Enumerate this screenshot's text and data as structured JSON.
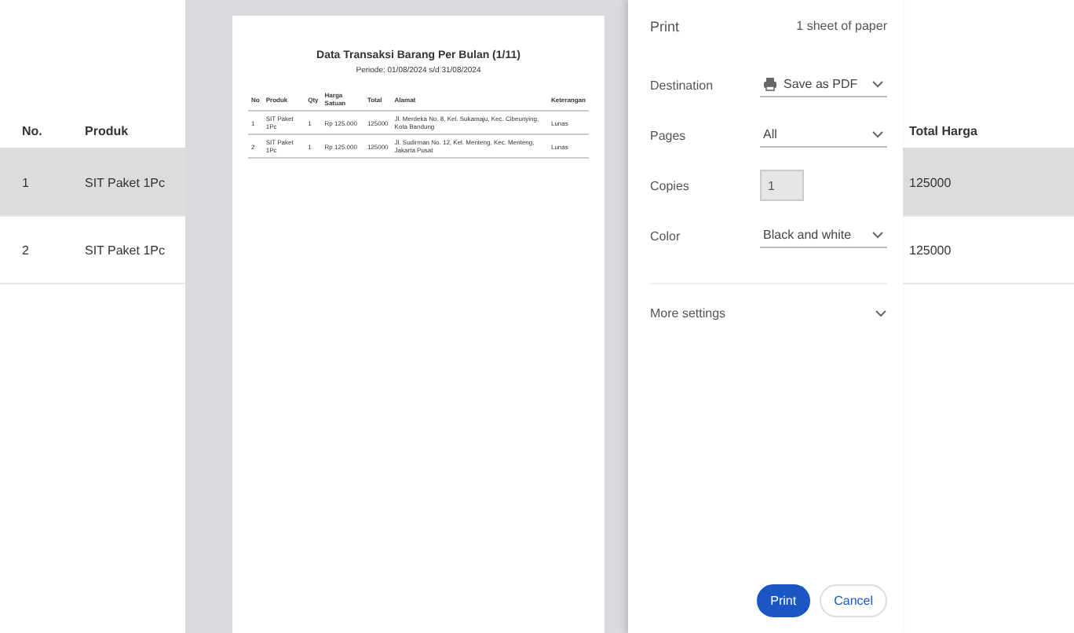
{
  "background_table": {
    "columns": [
      "No.",
      "Produk"
    ],
    "right_column": "Total Harga",
    "rows": [
      {
        "no": "1",
        "product": "SIT Paket 1Pc",
        "amount": "125000",
        "selected": true
      },
      {
        "no": "2",
        "product": "SIT Paket 1Pc",
        "amount": "125000",
        "selected": false
      }
    ]
  },
  "preview": {
    "title": "Data Transaksi Barang Per Bulan (1/11)",
    "subtitle": "Periode: 01/08/2024 s/d 31/08/2024",
    "columns": [
      "No",
      "Produk",
      "Qty",
      "Harga Satuan",
      "Total",
      "Alamat",
      "Keterangan"
    ],
    "rows": [
      [
        "1",
        "SIT Paket 1Pc",
        "1",
        "Rp 125.000",
        "125000",
        "Jl. Merdeka No. 8, Kel. Sukamaju, Kec. Cibeunying, Kota Bandung",
        "Lunas"
      ],
      [
        "2",
        "SIT Paket 1Pc",
        "1",
        "Rp 125.000",
        "125000",
        "Jl. Sudirman No. 12, Kel. Menteng, Kec. Menteng, Jakarta Pusat",
        "Lunas"
      ]
    ]
  },
  "dialog": {
    "title": "Print",
    "sheets": "1 sheet of paper",
    "fields": [
      {
        "label": "Destination",
        "value": "Save as PDF",
        "kind": "select",
        "icon": true
      },
      {
        "label": "Pages",
        "value": "All",
        "kind": "select"
      },
      {
        "label": "Copies",
        "value": "1",
        "kind": "number",
        "disabled": true
      },
      {
        "label": "Color",
        "value": "Black and white",
        "kind": "select"
      }
    ],
    "more": "More settings",
    "buttons": [
      {
        "label": "Print",
        "primary": true
      },
      {
        "label": "Cancel",
        "primary": false
      }
    ]
  }
}
